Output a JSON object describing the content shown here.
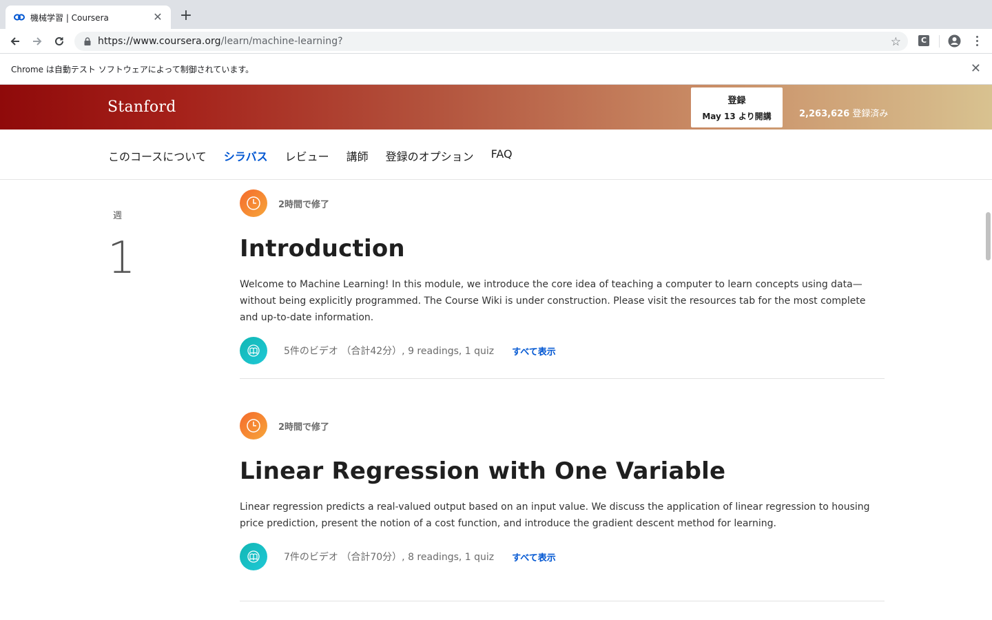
{
  "browser": {
    "tab_title": "機械学習 | Coursera",
    "url_host": "https://www.coursera.org",
    "url_path": "/learn/machine-learning?",
    "extension_letter": "C",
    "infobar_text": "Chrome は自動テスト ソフトウェアによって制御されています。"
  },
  "header": {
    "logo": "Stanford",
    "enroll_label": "登録",
    "enroll_start": "May 13 より開講",
    "enrolled_count": "2,263,626",
    "enrolled_suffix": " 登録済み",
    "brand_colors": [
      "#8f0a0a",
      "#d8c290"
    ]
  },
  "nav": {
    "items": [
      {
        "label": "このコースについて"
      },
      {
        "label": "シラバス"
      },
      {
        "label": "レビュー"
      },
      {
        "label": "講師"
      },
      {
        "label": "登録のオプション"
      },
      {
        "label": "FAQ"
      }
    ],
    "active": "シラバス"
  },
  "week": {
    "label": "週",
    "number": "1"
  },
  "modules": [
    {
      "duration": "2時間で修了",
      "title": "Introduction",
      "description": "Welcome to Machine Learning! In this module, we introduce the core idea of teaching a computer to learn concepts using data—without being explicitly programmed. The Course Wiki is under construction. Please visit the resources tab for the most complete and up-to-date information.",
      "meta": "5件のビデオ （合計42分）, 9 readings, 1 quiz",
      "show_all": "すべて表示"
    },
    {
      "duration": "2時間で修了",
      "title": "Linear Regression with One Variable",
      "description": "Linear regression predicts a real-valued output based on an input value. We discuss the application of linear regression to housing price prediction, present the notion of a cost function, and introduce the gradient descent method for learning.",
      "meta": "7件のビデオ （合計70分）, 8 readings, 1 quiz",
      "show_all": "すべて表示"
    }
  ],
  "icons": {
    "clock": "clock-icon",
    "book": "book-icon"
  },
  "colors": {
    "link": "#0056d2",
    "clock_gradient": [
      "#f46a2c",
      "#f7a63a"
    ],
    "book_gradient": [
      "#12b7b4",
      "#1fc8d6"
    ]
  }
}
